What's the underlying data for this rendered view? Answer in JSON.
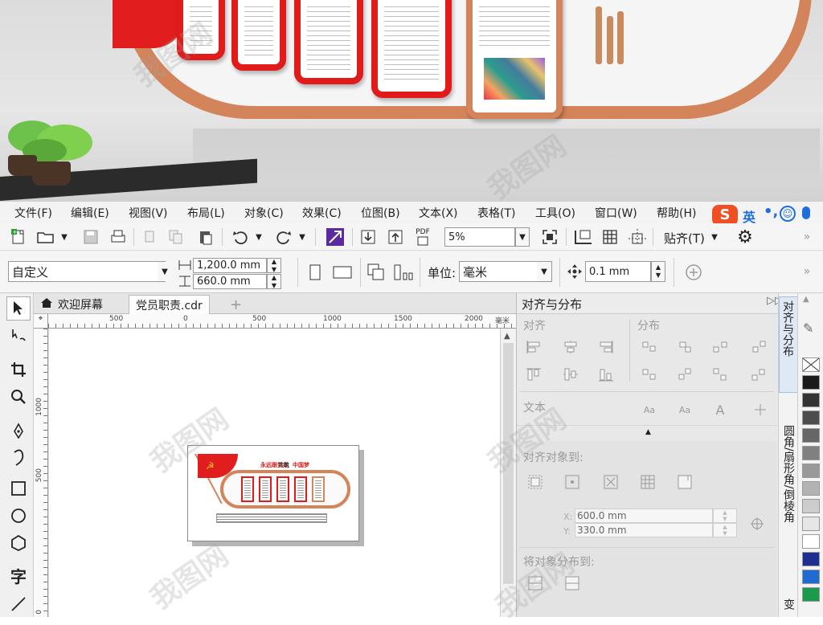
{
  "menu": [
    "文件(F)",
    "编辑(E)",
    "视图(V)",
    "布局(L)",
    "对象(C)",
    "效果(C)",
    "位图(B)",
    "文本(X)",
    "表格(T)",
    "工具(O)",
    "窗口(W)",
    "帮助(H)"
  ],
  "ime": {
    "logo": "S",
    "lang": "英",
    "punct": "•,",
    "emoji": "☺"
  },
  "toolbar": {
    "zoom_value": "5%",
    "snap_label": "贴齐(T)",
    "pdf_label": "PDF"
  },
  "propbar": {
    "page_size": "自定义",
    "width": "1,200.0 mm",
    "height": "660.0 mm",
    "unit_label": "单位:",
    "unit_value": "毫米",
    "nudge": "0.1 mm"
  },
  "tabs": {
    "welcome": "欢迎屏幕",
    "document": "党员职责.cdr",
    "add": "+"
  },
  "ruler": {
    "h_labels": [
      "500",
      "0",
      "500",
      "1000",
      "1500",
      "2000"
    ],
    "unit": "毫米",
    "v_labels": [
      "1000",
      "500",
      "0"
    ]
  },
  "design": {
    "title_a": "永远跟党走",
    "title_b": "共筑",
    "title_c": "中国梦",
    "title_d": "",
    "flag_mark": "☭"
  },
  "docker": {
    "title": "对齐与分布",
    "align": "对齐",
    "distribute": "分布",
    "text": "文本",
    "align_to": "对齐对象到:",
    "x_label": "X:",
    "x_value": "600.0 mm",
    "y_label": "Y:",
    "y_value": "330.0 mm",
    "distribute_to": "将对象分布到:"
  },
  "vtabs": {
    "align": "对齐与分布",
    "corner": "圆角/扇形角/倒棱角",
    "transform": "变"
  },
  "palette": [
    "#1a1a1a",
    "#333333",
    "#4d4d4d",
    "#666666",
    "#808080",
    "#999999",
    "#b3b3b3",
    "#cccccc",
    "#e6e6e6",
    "#ffffff",
    "#1f2f8f",
    "#1f6bd1",
    "#1a9a4a"
  ],
  "watermark": "我图网"
}
